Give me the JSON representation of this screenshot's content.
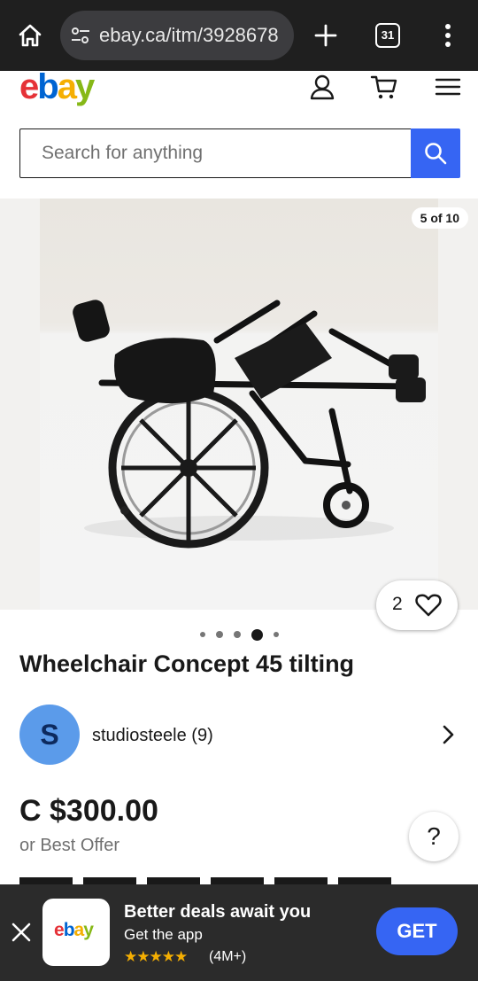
{
  "browser": {
    "url": "ebay.ca/itm/3928678",
    "tab_count": "31"
  },
  "logo": {
    "letters": [
      "e",
      "b",
      "a",
      "y"
    ],
    "colors": [
      "#e53238",
      "#0064d2",
      "#f5af02",
      "#86b817"
    ]
  },
  "search": {
    "placeholder": "Search for anything"
  },
  "gallery": {
    "counter": "5 of 10",
    "watch_count": "2",
    "dots_total": 5,
    "active_dot": 4
  },
  "item": {
    "title": "Wheelchair Concept 45 tilting",
    "seller_initial": "S",
    "seller_name": "studiosteele (9)",
    "price": "C $300.00",
    "offer_text": "or Best Offer",
    "help_label": "?"
  },
  "app_banner": {
    "headline": "Better deals await you",
    "subtext": "Get the app",
    "stars": "★★★★★",
    "rating": "(4M+)",
    "get_label": "GET"
  },
  "colors": {
    "accent": "#3665f3",
    "avatar": "#5b9bea",
    "banner_bg": "#2b2b2b",
    "chrome_bg": "#1f1f1f"
  }
}
